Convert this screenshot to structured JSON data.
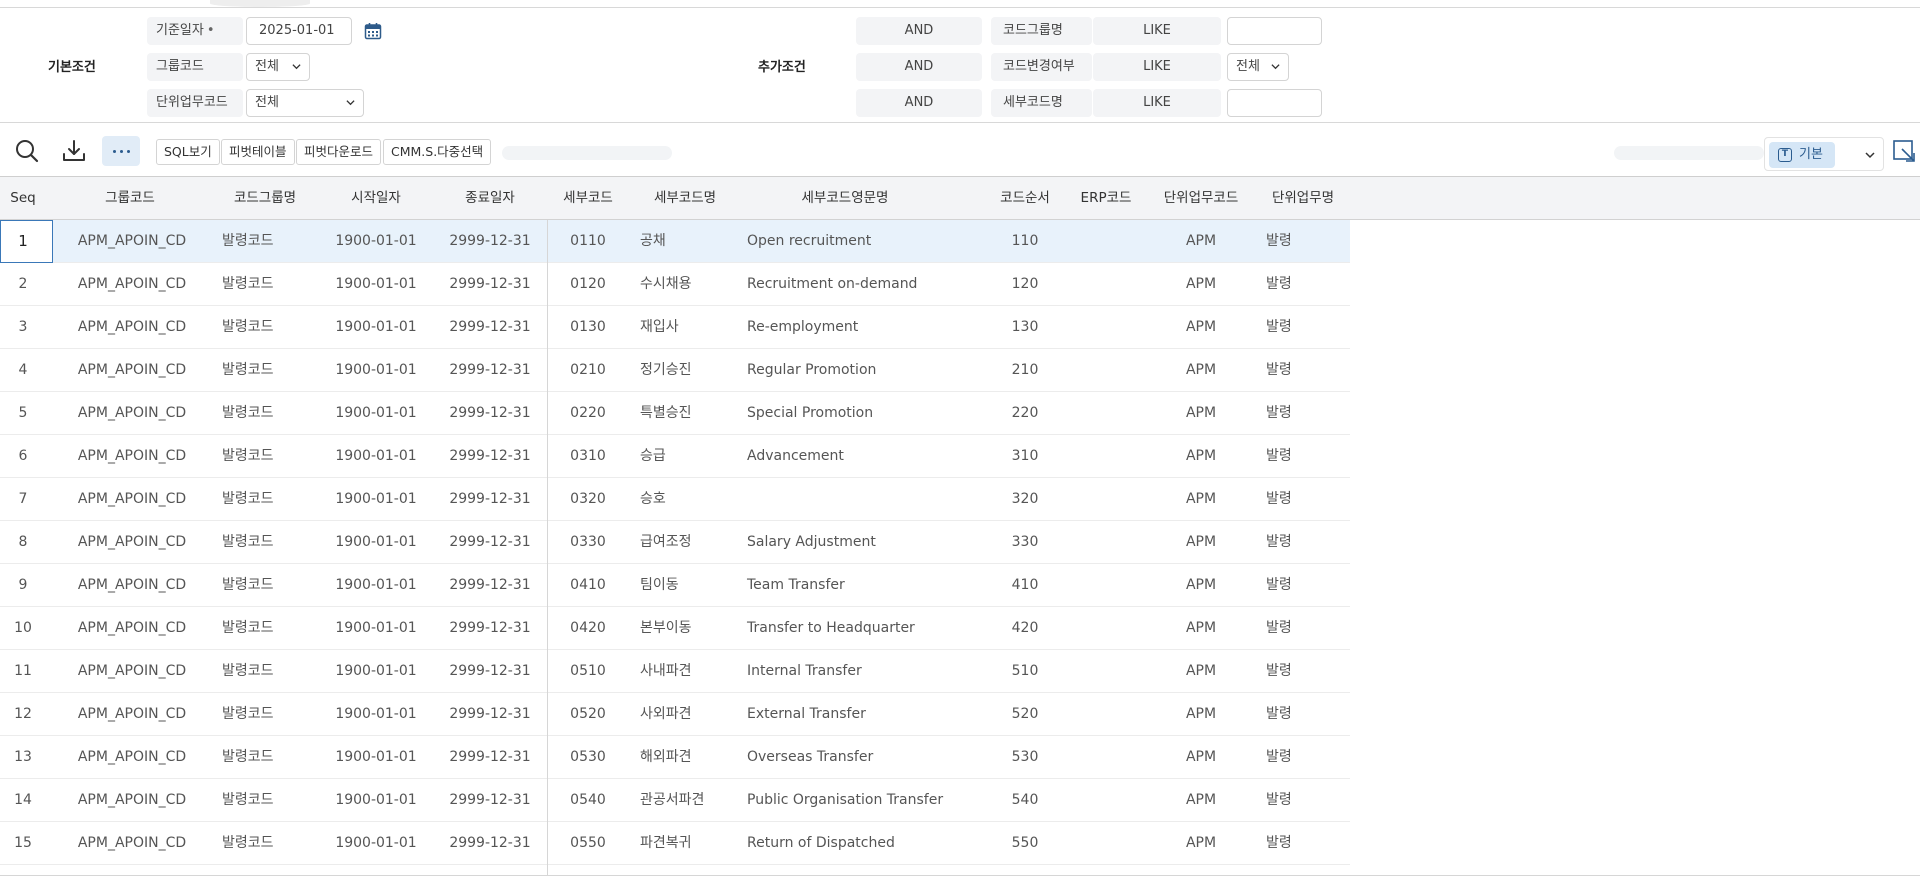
{
  "conditions": {
    "basic_label": "기본조건",
    "extra_label": "추가조건",
    "base_date_label": "기준일자",
    "base_date_required": "•",
    "base_date_value": "2025-01-01",
    "group_code_label": "그룹코드",
    "group_code_value": "전체",
    "unit_task_label": "단위업무코드",
    "unit_task_value": "전체",
    "extra_rows": [
      {
        "op": "AND",
        "field": "코드그룹명",
        "cmp": "LIKE",
        "value": ""
      },
      {
        "op": "AND",
        "field": "코드변경여부",
        "cmp": "LIKE",
        "value": "전체"
      },
      {
        "op": "AND",
        "field": "세부코드명",
        "cmp": "LIKE",
        "value": ""
      }
    ]
  },
  "toolbar": {
    "search_icon": "search-icon",
    "download_icon": "download-icon",
    "more_icon": "more-icon",
    "buttons": [
      "SQL보기",
      "피벗테이블",
      "피벗다운로드",
      "CMM.S.다중선택"
    ],
    "view_label": "기본",
    "view_icon": "template-icon"
  },
  "grid": {
    "headers": [
      "Seq",
      "그룹코드",
      "코드그룹명",
      "시작일자",
      "종료일자",
      "세부코드",
      "세부코드명",
      "세부코드영문명",
      "코드순서",
      "ERP코드",
      "단위업무코드",
      "단위업무명"
    ],
    "rows": [
      [
        "1",
        "APM_APOIN_CD",
        "발령코드",
        "1900-01-01",
        "2999-12-31",
        "0110",
        "공채",
        "Open recruitment",
        "110",
        "",
        "APM",
        "발령"
      ],
      [
        "2",
        "APM_APOIN_CD",
        "발령코드",
        "1900-01-01",
        "2999-12-31",
        "0120",
        "수시채용",
        "Recruitment on-demand",
        "120",
        "",
        "APM",
        "발령"
      ],
      [
        "3",
        "APM_APOIN_CD",
        "발령코드",
        "1900-01-01",
        "2999-12-31",
        "0130",
        "재입사",
        "Re-employment",
        "130",
        "",
        "APM",
        "발령"
      ],
      [
        "4",
        "APM_APOIN_CD",
        "발령코드",
        "1900-01-01",
        "2999-12-31",
        "0210",
        "정기승진",
        "Regular Promotion",
        "210",
        "",
        "APM",
        "발령"
      ],
      [
        "5",
        "APM_APOIN_CD",
        "발령코드",
        "1900-01-01",
        "2999-12-31",
        "0220",
        "특별승진",
        "Special Promotion",
        "220",
        "",
        "APM",
        "발령"
      ],
      [
        "6",
        "APM_APOIN_CD",
        "발령코드",
        "1900-01-01",
        "2999-12-31",
        "0310",
        "승급",
        "Advancement",
        "310",
        "",
        "APM",
        "발령"
      ],
      [
        "7",
        "APM_APOIN_CD",
        "발령코드",
        "1900-01-01",
        "2999-12-31",
        "0320",
        "승호",
        "",
        "320",
        "",
        "APM",
        "발령"
      ],
      [
        "8",
        "APM_APOIN_CD",
        "발령코드",
        "1900-01-01",
        "2999-12-31",
        "0330",
        "급여조정",
        "Salary Adjustment",
        "330",
        "",
        "APM",
        "발령"
      ],
      [
        "9",
        "APM_APOIN_CD",
        "발령코드",
        "1900-01-01",
        "2999-12-31",
        "0410",
        "팀이동",
        "Team Transfer",
        "410",
        "",
        "APM",
        "발령"
      ],
      [
        "10",
        "APM_APOIN_CD",
        "발령코드",
        "1900-01-01",
        "2999-12-31",
        "0420",
        "본부이동",
        "Transfer to Headquarter",
        "420",
        "",
        "APM",
        "발령"
      ],
      [
        "11",
        "APM_APOIN_CD",
        "발령코드",
        "1900-01-01",
        "2999-12-31",
        "0510",
        "사내파견",
        "Internal Transfer",
        "510",
        "",
        "APM",
        "발령"
      ],
      [
        "12",
        "APM_APOIN_CD",
        "발령코드",
        "1900-01-01",
        "2999-12-31",
        "0520",
        "사외파견",
        "External Transfer",
        "520",
        "",
        "APM",
        "발령"
      ],
      [
        "13",
        "APM_APOIN_CD",
        "발령코드",
        "1900-01-01",
        "2999-12-31",
        "0530",
        "해외파견",
        "Overseas Transfer",
        "530",
        "",
        "APM",
        "발령"
      ],
      [
        "14",
        "APM_APOIN_CD",
        "발령코드",
        "1900-01-01",
        "2999-12-31",
        "0540",
        "관공서파견",
        "Public Organisation Transfer",
        "540",
        "",
        "APM",
        "발령"
      ],
      [
        "15",
        "APM_APOIN_CD",
        "발령코드",
        "1900-01-01",
        "2999-12-31",
        "0550",
        "파견복귀",
        "Return of Dispatched",
        "550",
        "",
        "APM",
        "발령"
      ]
    ],
    "selected_row": 0
  },
  "colors": {
    "selected_row_bg": "#e8f2fb",
    "focus_border": "#3a78b8",
    "header_bg": "#f3f4f6",
    "accent": "#2b5c8f"
  }
}
